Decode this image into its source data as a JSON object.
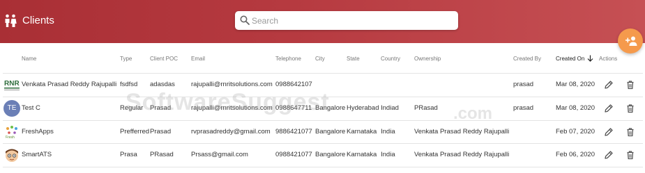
{
  "header": {
    "title": "Clients",
    "icon": "people-icon"
  },
  "search": {
    "placeholder": "Search",
    "value": ""
  },
  "fab": {
    "icon": "add-person-icon",
    "color": "#f59a4c"
  },
  "colors": {
    "header": "#b63a40",
    "fab": "#f59a4c",
    "avatar_letters": "#6b7fb6"
  },
  "table": {
    "columns": {
      "name": "Name",
      "type": "Type",
      "client_poc": "Client POC",
      "email": "Email",
      "telephone": "Telephone",
      "city": "City",
      "state": "State",
      "country": "Country",
      "ownership": "Ownership",
      "created_by": "Created By",
      "created_on": "Created On",
      "actions": "Actions"
    },
    "sort": {
      "column": "Created On",
      "direction": "descending"
    },
    "rows": [
      {
        "avatar_icon": "rnr-logo-icon",
        "avatar_text": "RNR",
        "name": "Venkata Prasad Reddy Rajupalli",
        "type": "fsdfsd",
        "client_poc": "adasdas",
        "email": "rajupalli@rnritsolutions.com",
        "telephone": "0988642107",
        "city": "",
        "state": "",
        "country": "",
        "ownership": "",
        "created_by": "prasad",
        "created_on": "Mar 08, 2020"
      },
      {
        "avatar_icon": "initials-avatar-icon",
        "avatar_text": "TE",
        "name": "Test C",
        "type": "Regular",
        "client_poc": "Prasad",
        "email": "rajupalli@rnritsolutions.com",
        "telephone": "0988647711",
        "city": "Bangalore",
        "state": "Hyderabad",
        "country": "Indiad",
        "ownership": "PRasad",
        "created_by": "prasad",
        "created_on": "Mar 08, 2020"
      },
      {
        "avatar_icon": "freshapps-logo-icon",
        "avatar_text": "",
        "name": "FreshApps",
        "type": "Prefferred",
        "client_poc": "Prasad",
        "email": "rvprasadreddy@gmail.com",
        "telephone": "9886421077",
        "city": "Bangalore",
        "state": "Karnataka",
        "country": "India",
        "ownership": "Venkata Prasad Reddy Rajupalli",
        "created_by": "",
        "created_on": "Feb 07, 2020"
      },
      {
        "avatar_icon": "cartoon-face-avatar-icon",
        "avatar_text": "",
        "name": "SmartATS",
        "type": "Prasa",
        "client_poc": "PRasad",
        "email": "Prsass@gmail.com",
        "telephone": "0988421077",
        "city": "Bangalore",
        "state": "Karnataka",
        "country": "India",
        "ownership": "Venkata Prasad Reddy Rajupalli",
        "created_by": "",
        "created_on": "Feb 06, 2020"
      }
    ]
  },
  "watermark": {
    "text": "SoftwareSuggest",
    "suffix": ".com"
  }
}
